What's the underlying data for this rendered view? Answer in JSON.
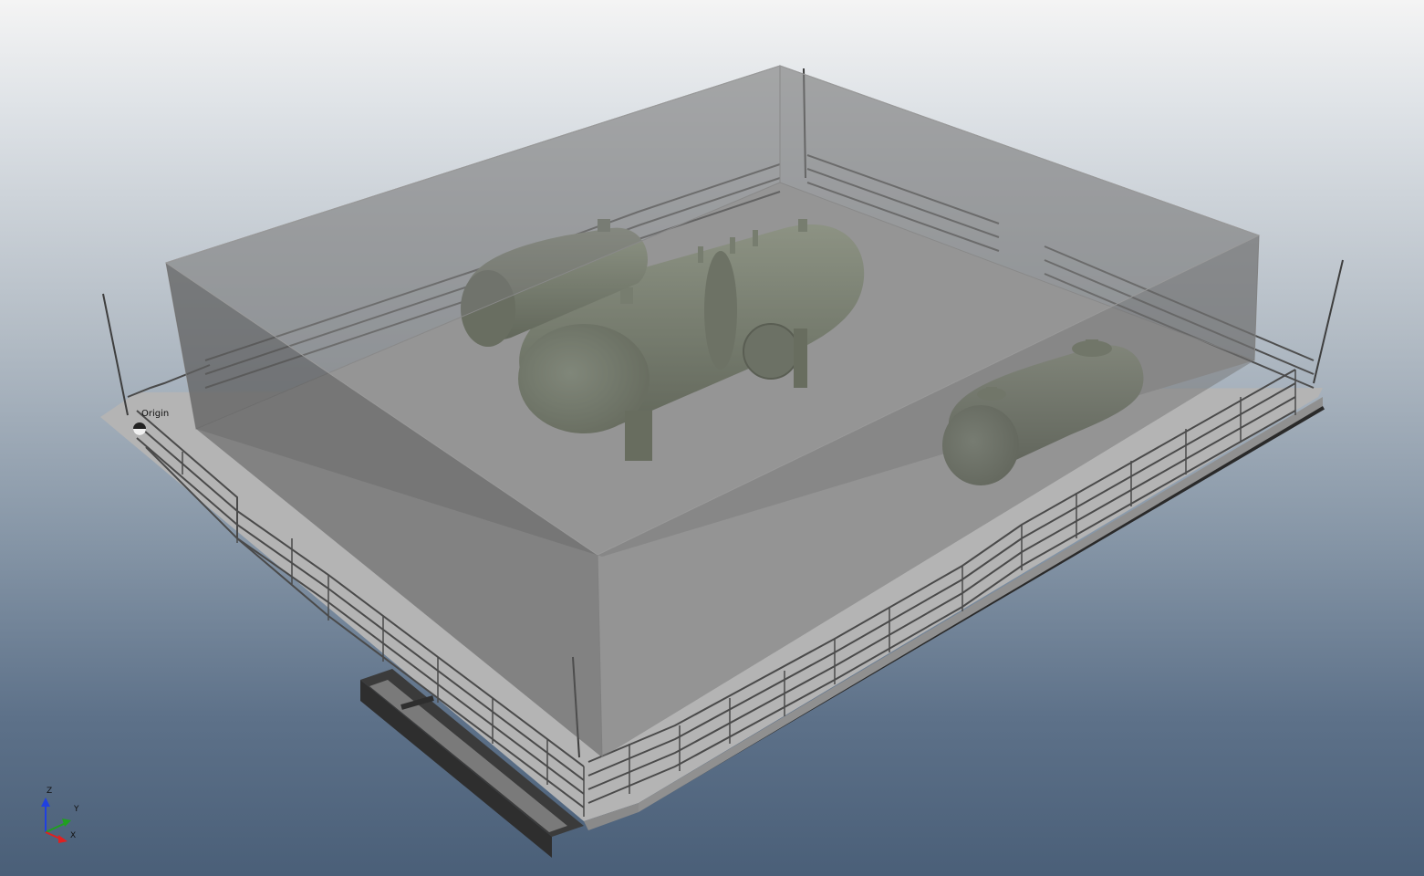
{
  "viewport": {
    "origin_label": "Origin",
    "axis_labels": {
      "x": "X",
      "y": "Y",
      "z": "Z"
    },
    "colors": {
      "vessel": "#6c7560",
      "vessel_dark": "#4c5441",
      "vessel_light": "#8a937c",
      "floor": "#b8b8b8",
      "railing": "#5a5a5a",
      "frame": "#3a3a3a",
      "room_tint": "#6e6e6e",
      "axis_x": "#e02020",
      "axis_y": "#20a020",
      "axis_z": "#2040e0"
    }
  }
}
